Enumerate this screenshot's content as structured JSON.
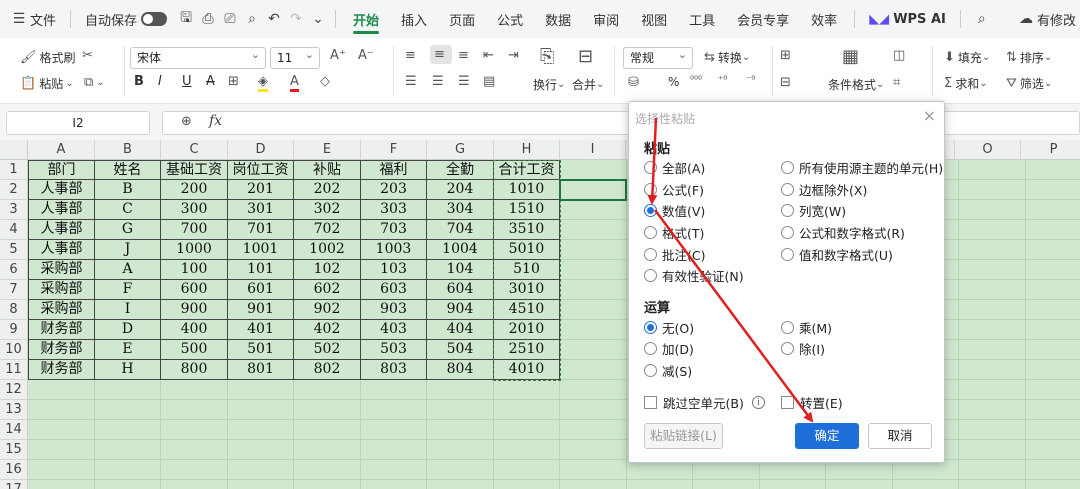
{
  "menubar": {
    "file_label": "文件",
    "autosave_label": "自动保存",
    "tabs": [
      "开始",
      "插入",
      "页面",
      "公式",
      "数据",
      "审阅",
      "视图",
      "工具",
      "会员专享",
      "效率"
    ],
    "active_tab": "开始",
    "wps_ai_label": "WPS AI",
    "edit_status_label": "有修改"
  },
  "ribbon": {
    "format_painter": "格式刷",
    "paste": "粘贴",
    "font_name": "宋体",
    "font_size": "11",
    "bold": "B",
    "italic": "I",
    "underline": "U",
    "strike": "A",
    "wrap_label": "换行",
    "merge_label": "合并",
    "number_format": "常规",
    "convert_label": "转换",
    "conditional_label": "条件格式",
    "fill_label": "填充",
    "sort_label": "排序",
    "sum_label": "求和",
    "filter_label": "筛选",
    "percent": "%"
  },
  "formula_bar": {
    "name_box": "I2",
    "fx_label": "fx",
    "formula": ""
  },
  "sheet": {
    "columns": [
      "A",
      "B",
      "C",
      "D",
      "E",
      "F",
      "G",
      "H",
      "I",
      "O",
      "P"
    ],
    "rows": [
      "1",
      "2",
      "3",
      "4",
      "5",
      "6",
      "7",
      "8",
      "9",
      "10",
      "11",
      "12",
      "13",
      "14",
      "15",
      "16",
      "17"
    ],
    "header": [
      "部门",
      "姓名",
      "基础工资",
      "岗位工资",
      "补贴",
      "福利",
      "全勤",
      "合计工资"
    ],
    "data": [
      [
        "人事部",
        "B",
        "200",
        "201",
        "202",
        "203",
        "204",
        "1010"
      ],
      [
        "人事部",
        "C",
        "300",
        "301",
        "302",
        "303",
        "304",
        "1510"
      ],
      [
        "人事部",
        "G",
        "700",
        "701",
        "702",
        "703",
        "704",
        "3510"
      ],
      [
        "人事部",
        "J",
        "1000",
        "1001",
        "1002",
        "1003",
        "1004",
        "5010"
      ],
      [
        "采购部",
        "A",
        "100",
        "101",
        "102",
        "103",
        "104",
        "510"
      ],
      [
        "采购部",
        "F",
        "600",
        "601",
        "602",
        "603",
        "604",
        "3010"
      ],
      [
        "采购部",
        "I",
        "900",
        "901",
        "902",
        "903",
        "904",
        "4510"
      ],
      [
        "财务部",
        "D",
        "400",
        "401",
        "402",
        "403",
        "404",
        "2010"
      ],
      [
        "财务部",
        "E",
        "500",
        "501",
        "502",
        "503",
        "504",
        "2510"
      ],
      [
        "财务部",
        "H",
        "800",
        "801",
        "802",
        "803",
        "804",
        "4010"
      ]
    ]
  },
  "dialog": {
    "title": "选择性粘贴",
    "paste_section": "粘贴",
    "paste_options": [
      "全部(A)",
      "所有使用源主题的单元(H)",
      "公式(F)",
      "边框除外(X)",
      "数值(V)",
      "列宽(W)",
      "格式(T)",
      "公式和数字格式(R)",
      "批注(C)",
      "值和数字格式(U)",
      "有效性验证(N)"
    ],
    "paste_selected": "数值(V)",
    "operation_section": "运算",
    "operation_options": [
      "无(O)",
      "乘(M)",
      "加(D)",
      "除(I)",
      "减(S)"
    ],
    "operation_selected": "无(O)",
    "skip_blanks": "跳过空单元(B)",
    "transpose": "转置(E)",
    "paste_link": "粘贴链接(L)",
    "ok": "确定",
    "cancel": "取消"
  },
  "colors": {
    "accent": "#1f8a4c",
    "grid_green": "#cfe8cf",
    "primary_button": "#1e6fd9",
    "annotation_arrow": "#e02020"
  }
}
